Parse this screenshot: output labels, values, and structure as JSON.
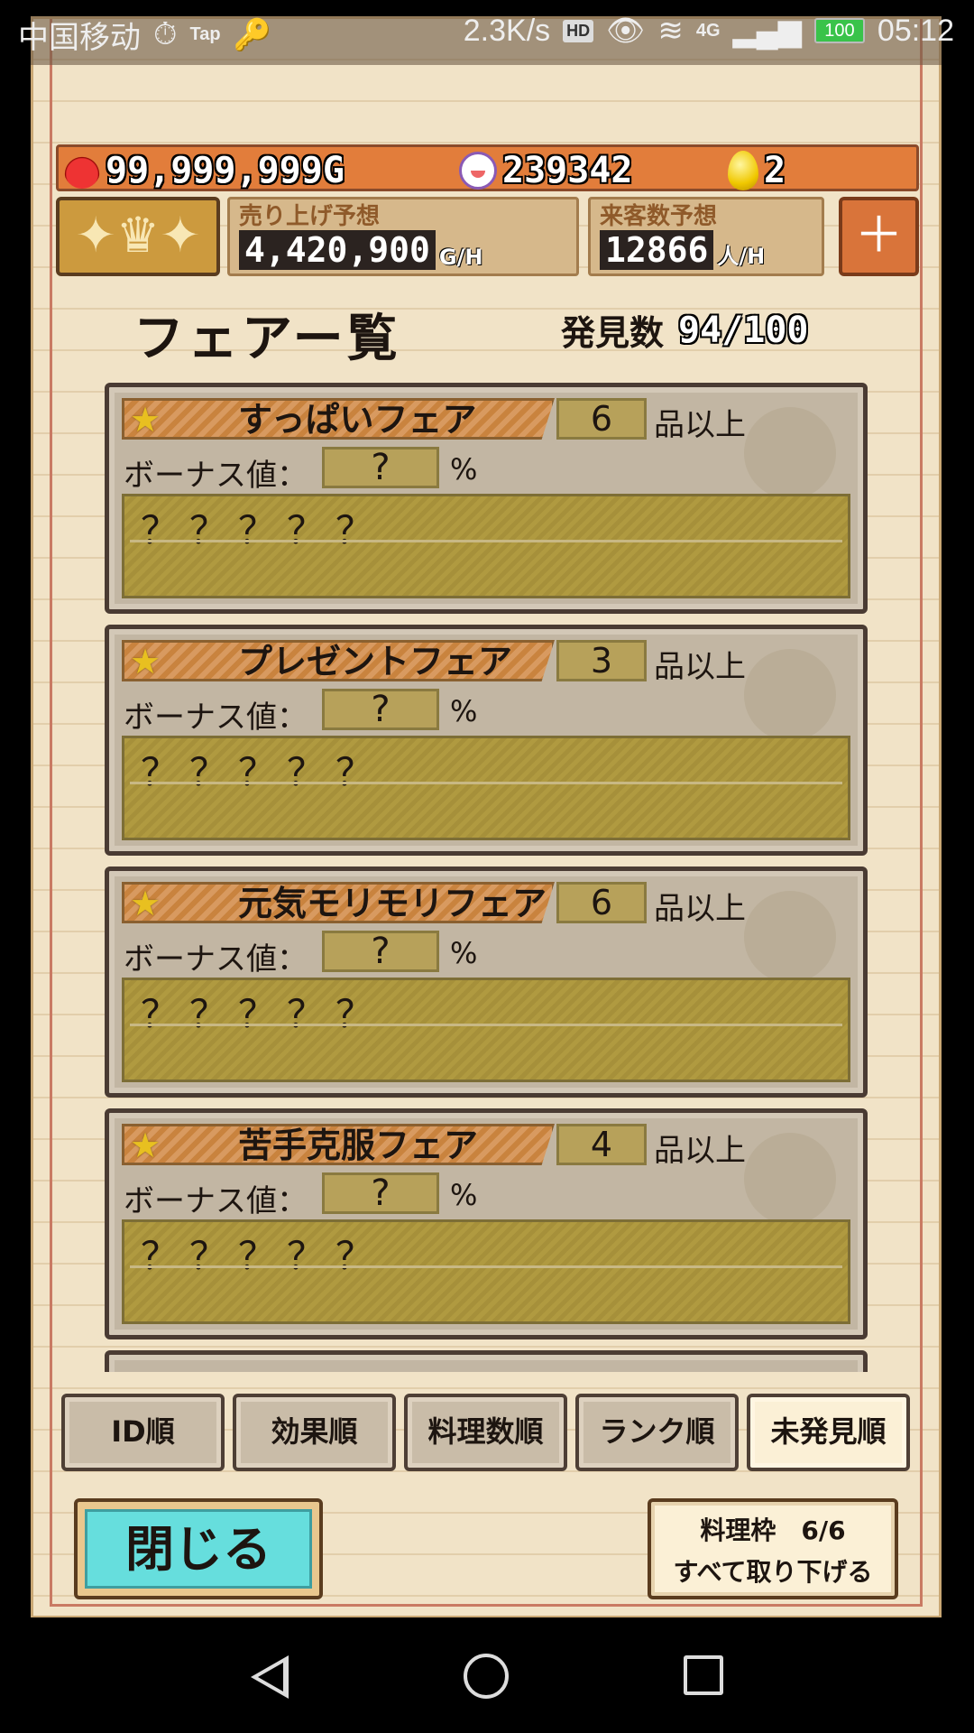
{
  "status_bar": {
    "carrier": "中国移动",
    "app_label": "Tap",
    "speed": "2.3K/s",
    "hd": "HD",
    "network": "4G",
    "battery": "100",
    "time": "05:12"
  },
  "resources": {
    "gold": "99,999,999G",
    "guests": "239342",
    "eggs": "2"
  },
  "forecast": {
    "sales_label": "売り上げ予想",
    "sales_value": "4,420,900",
    "sales_unit": "G/H",
    "visitors_label": "来客数予想",
    "visitors_value": "12866",
    "visitors_unit": "人/H"
  },
  "page": {
    "title": "フェアー覧",
    "found_label": "発見数",
    "found_value": "94/100"
  },
  "card_labels": {
    "count_suffix": "品以上",
    "bonus_label": "ボーナス値：",
    "bonus_unit": "%"
  },
  "fairs": [
    {
      "name": "すっぱいフェア",
      "count": "6",
      "bonus": "?",
      "desc": "？？？？？"
    },
    {
      "name": "プレゼントフェア",
      "count": "3",
      "bonus": "?",
      "desc": "？？？？？"
    },
    {
      "name": "元気モリモリフェア",
      "count": "6",
      "bonus": "?",
      "desc": "？？？？？"
    },
    {
      "name": "苦手克服フェア",
      "count": "4",
      "bonus": "?",
      "desc": "？？？？？"
    }
  ],
  "sort_buttons": [
    {
      "label": "ID順",
      "active": false
    },
    {
      "label": "効果順",
      "active": false
    },
    {
      "label": "料理数順",
      "active": false
    },
    {
      "label": "ランク順",
      "active": false
    },
    {
      "label": "未発見順",
      "active": true
    }
  ],
  "footer": {
    "close_label": "閉じる",
    "slot_line": "料理枠　6/6",
    "remove_all_label": "すべて取り下げる"
  },
  "icons": [
    "wallet-icon",
    "guest-face-icon",
    "golden-egg-icon",
    "crown-icon",
    "add-staff-icon",
    "star-icon",
    "chef-emblem-icon",
    "back-nav-icon",
    "home-nav-icon",
    "recent-apps-icon"
  ]
}
